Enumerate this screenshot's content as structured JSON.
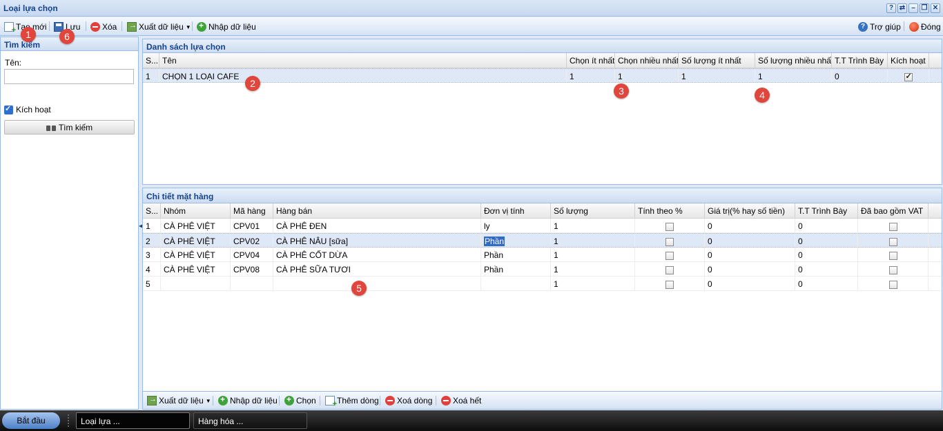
{
  "window": {
    "title": "Loại lựa chọn",
    "tools": [
      "?",
      "⇄",
      "–",
      "❐",
      "✕"
    ]
  },
  "toolbar": {
    "new_label": "Tạo mới",
    "save_label": "Lưu",
    "delete_label": "Xóa",
    "export_label": "Xuất dữ liệu",
    "import_label": "Nhập dữ liệu",
    "help_label": "Trợ giúp",
    "close_label": "Đóng"
  },
  "search": {
    "title": "Tìm kiếm",
    "name_label": "Tên:",
    "name_value": "",
    "active_label": "Kích hoạt",
    "active_checked": true,
    "button_label": "Tìm kiếm"
  },
  "options_grid": {
    "title": "Danh sách lựa chọn",
    "columns": [
      "S...",
      "Tên",
      "Chọn ít nhất",
      "Chọn nhiều nhất",
      "Số lượng ít nhất",
      "Số lượng nhiều nhất",
      "T.T Trình Bày",
      "Kích hoạt"
    ],
    "rows": [
      {
        "stt": "1",
        "name": "CHỌN 1 LOẠI CAFE",
        "min_choose": "1",
        "max_choose": "1",
        "min_qty": "1",
        "max_qty": "1",
        "order": "0",
        "active": true
      }
    ]
  },
  "items_grid": {
    "title": "Chi tiết mặt hàng",
    "columns": [
      "S...",
      "Nhóm",
      "Mã hàng",
      "Hàng bán",
      "Đơn vị tính",
      "Số lượng",
      "Tính theo %",
      "Giá trị(% hay số tiền)",
      "T.T Trình Bày",
      "Đã bao gồm VAT"
    ],
    "rows": [
      {
        "stt": "1",
        "group": "CÀ PHÊ VIỆT",
        "code": "CPV01",
        "item": "CÀ PHÊ ĐEN",
        "unit": "ly",
        "qty": "1",
        "value": "0",
        "order": "0"
      },
      {
        "stt": "2",
        "group": "CÀ PHÊ VIỆT",
        "code": "CPV02",
        "item": "CÀ PHÊ NÂU [sữa]",
        "unit": "Phần",
        "qty": "1",
        "value": "0",
        "order": "0"
      },
      {
        "stt": "3",
        "group": "CÀ PHÊ VIỆT",
        "code": "CPV04",
        "item": "CÀ PHÊ CỐT DỪA",
        "unit": "Phần",
        "qty": "1",
        "value": "0",
        "order": "0"
      },
      {
        "stt": "4",
        "group": "CÀ PHÊ VIỆT",
        "code": "CPV08",
        "item": "CÀ PHÊ SỮA TƯƠI",
        "unit": "Phần",
        "qty": "1",
        "value": "0",
        "order": "0"
      },
      {
        "stt": "5",
        "group": "",
        "code": "",
        "item": "",
        "unit": "",
        "qty": "1",
        "value": "0",
        "order": "0"
      }
    ]
  },
  "bottom_toolbar": {
    "export_label": "Xuất dữ liệu",
    "import_label": "Nhập dữ liệu",
    "choose_label": "Chọn",
    "add_row_label": "Thêm dòng",
    "delete_row_label": "Xoá dòng",
    "delete_all_label": "Xoá hết"
  },
  "badges": [
    "1",
    "6",
    "2",
    "3",
    "4",
    "5"
  ],
  "taskbar": {
    "start_label": "Bắt đầu",
    "tasks": [
      "Loại lựa ...",
      "Hàng hóa ..."
    ]
  },
  "colors": {
    "header_text": "#15428b",
    "panel_border": "#99bbe8",
    "badge": "#e0463b",
    "selection": "#dfe8f6"
  }
}
